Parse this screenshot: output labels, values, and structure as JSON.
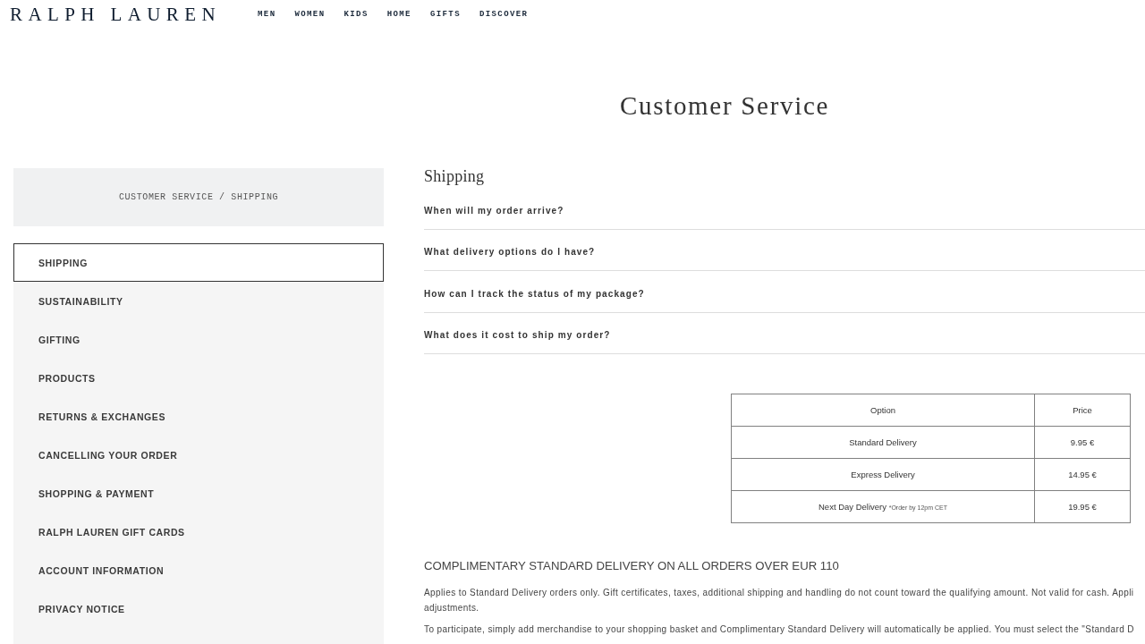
{
  "header": {
    "logo": "RALPH LAUREN",
    "nav": [
      "MEN",
      "WOMEN",
      "KIDS",
      "HOME",
      "GIFTS",
      "DISCOVER"
    ]
  },
  "page_title": "Customer Service",
  "sidebar": {
    "breadcrumb": "CUSTOMER SERVICE / SHIPPING",
    "items": [
      {
        "label": "SHIPPING",
        "selected": true
      },
      {
        "label": "SUSTAINABILITY",
        "selected": false
      },
      {
        "label": "GIFTING",
        "selected": false
      },
      {
        "label": "PRODUCTS",
        "selected": false
      },
      {
        "label": "RETURNS & EXCHANGES",
        "selected": false
      },
      {
        "label": "CANCELLING YOUR ORDER",
        "selected": false
      },
      {
        "label": "SHOPPING & PAYMENT",
        "selected": false
      },
      {
        "label": "RALPH LAUREN GIFT CARDS",
        "selected": false
      },
      {
        "label": "ACCOUNT INFORMATION",
        "selected": false
      },
      {
        "label": "PRIVACY NOTICE",
        "selected": false
      }
    ]
  },
  "content": {
    "heading": "Shipping",
    "faq": [
      "When will my order arrive?",
      "What delivery options do I have?",
      "How can I track the status of my package?",
      "What does it cost to ship my order?"
    ],
    "table": {
      "columns": [
        "Option",
        "Price"
      ],
      "rows": [
        {
          "option": "Standard Delivery",
          "price": "9.95 €"
        },
        {
          "option": "Express Delivery",
          "price": "14.95 €"
        },
        {
          "option": "Next Day Delivery",
          "note": "*Order by 12pm CET",
          "price": "19.95 €"
        }
      ]
    },
    "promo": {
      "heading": "COMPLIMENTARY STANDARD DELIVERY ON ALL ORDERS OVER EUR 110",
      "paragraphs": [
        {
          "lines": [
            "Applies to Standard Delivery orders only. Gift certificates, taxes, additional shipping and handling do not count toward the qualifying amount. Not valid for cash. Appli",
            "adjustments."
          ]
        },
        {
          "lines": [
            "To participate, simply add merchandise to your shopping basket and Complimentary Standard Delivery will automatically be applied. You must select the \"Standard D"
          ]
        }
      ]
    }
  }
}
